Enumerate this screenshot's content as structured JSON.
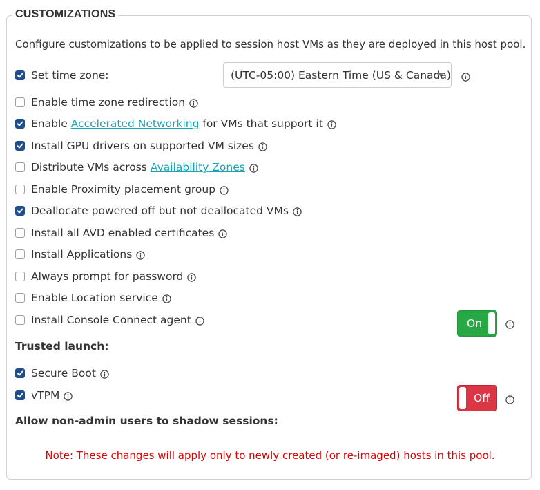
{
  "section": {
    "title": "CUSTOMIZATIONS",
    "description": "Configure customizations to be applied to session host VMs as they are deployed in this host pool."
  },
  "time_zone": {
    "label": "Set time zone:",
    "checked": true,
    "value": "(UTC-05:00) Eastern Time (US & Canada)"
  },
  "options": [
    {
      "label": "Enable time zone redirection",
      "checked": false
    },
    {
      "prefix": "Enable ",
      "link": "Accelerated Networking",
      "suffix": " for VMs that support it",
      "checked": true
    },
    {
      "label": "Install GPU drivers on supported VM sizes",
      "checked": true
    },
    {
      "prefix": "Distribute VMs across ",
      "link": "Availability Zones",
      "suffix": "",
      "checked": false
    },
    {
      "label": "Enable Proximity placement group",
      "checked": false
    },
    {
      "label": "Deallocate powered off but not deallocated VMs",
      "checked": true
    },
    {
      "label": "Install all AVD enabled certificates",
      "checked": false
    },
    {
      "label": "Install Applications",
      "checked": false
    },
    {
      "label": "Always prompt for password",
      "checked": false
    },
    {
      "label": "Enable Location service",
      "checked": false
    },
    {
      "label": "Install Console Connect agent",
      "checked": false
    }
  ],
  "trusted_launch": {
    "heading": "Trusted launch:",
    "toggle_label": "On",
    "items": [
      {
        "label": "Secure Boot",
        "checked": true
      },
      {
        "label": "vTPM",
        "checked": true
      }
    ]
  },
  "shadow": {
    "heading": "Allow non-admin users to shadow sessions:",
    "toggle_label": "Off"
  },
  "note": "Note: These changes will apply only to newly created (or re-imaged) hosts in this pool.",
  "colors": {
    "checkbox_checked": "#1f4e8c",
    "link": "#1aa3b3",
    "toggle_on": "#28a745",
    "toggle_off": "#dc3545",
    "note": "#e00000"
  }
}
